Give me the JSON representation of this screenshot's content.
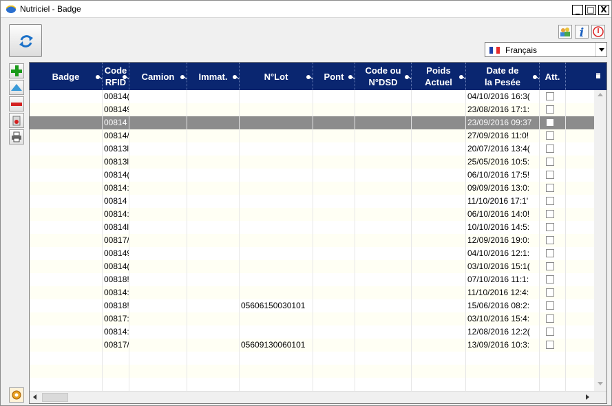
{
  "window": {
    "title": "Nutriciel - Badge",
    "minimize": "_",
    "maximize": "□",
    "close": "X"
  },
  "language": {
    "selected": "Français"
  },
  "colors": {
    "header_bg": "#0a2670",
    "selected_row": "#8c8c8c",
    "odd_row": "#fffff4",
    "add": "#1a9a1a",
    "remove": "#d32020"
  },
  "icons": {
    "refresh": "refresh-icon",
    "users": "users-icon",
    "info": "info-icon",
    "power": "power-icon",
    "add": "add-icon",
    "up": "move-up-icon",
    "remove": "remove-icon",
    "delete": "delete-icon",
    "print": "print-icon",
    "settings": "settings-icon"
  },
  "columns": [
    {
      "key": "badge",
      "label": "Badge"
    },
    {
      "key": "rfid",
      "label": "Code\nRFID"
    },
    {
      "key": "camion",
      "label": "Camion"
    },
    {
      "key": "immat",
      "label": "Immat."
    },
    {
      "key": "lot",
      "label": "N°Lot"
    },
    {
      "key": "pont",
      "label": "Pont"
    },
    {
      "key": "dsd",
      "label": "Code ou\nN°DSD"
    },
    {
      "key": "poids",
      "label": "Poids\nActuel"
    },
    {
      "key": "date",
      "label": "Date de\nla Pesée"
    },
    {
      "key": "att",
      "label": "Att."
    }
  ],
  "rows": [
    {
      "rfid": "00814(",
      "lot": "",
      "date": "04/10/2016 16:3("
    },
    {
      "rfid": "008149",
      "lot": "",
      "date": "23/08/2016 17:1:"
    },
    {
      "rfid": "00814",
      "lot": "",
      "date": "23/09/2016 09:37",
      "selected": true
    },
    {
      "rfid": "00814/",
      "lot": "",
      "date": "27/09/2016 11:0!"
    },
    {
      "rfid": "00813l",
      "lot": "",
      "date": "20/07/2016 13:4("
    },
    {
      "rfid": "00813l",
      "lot": "",
      "date": "25/05/2016 10:5:"
    },
    {
      "rfid": "00814(",
      "lot": "",
      "date": "06/10/2016 17:5!"
    },
    {
      "rfid": "00814:",
      "lot": "",
      "date": "09/09/2016 13:0:"
    },
    {
      "rfid": "00814",
      "lot": "",
      "date": "11/10/2016 17:1'"
    },
    {
      "rfid": "00814:",
      "lot": "",
      "date": "06/10/2016 14:0!"
    },
    {
      "rfid": "00814l",
      "lot": "",
      "date": "10/10/2016 14:5:"
    },
    {
      "rfid": "00817/",
      "lot": "",
      "date": "12/09/2016 19:0:"
    },
    {
      "rfid": "008149",
      "lot": "",
      "date": "04/10/2016 12:1:"
    },
    {
      "rfid": "00814(",
      "lot": "",
      "date": "03/10/2016 15:1("
    },
    {
      "rfid": "00818!",
      "lot": "",
      "date": "07/10/2016 11:1:"
    },
    {
      "rfid": "00814:",
      "lot": "",
      "date": "11/10/2016 12:4:"
    },
    {
      "rfid": "00818!",
      "lot": "05606150030101",
      "date": "15/06/2016 08:2:"
    },
    {
      "rfid": "00817:",
      "lot": "",
      "date": "03/10/2016 15:4:"
    },
    {
      "rfid": "00814:",
      "lot": "",
      "date": "12/08/2016 12:2("
    },
    {
      "rfid": "00817/",
      "lot": "05609130060101",
      "date": "13/09/2016 10:3:"
    },
    {
      "rfid": "",
      "lot": "",
      "date": "",
      "empty": true
    },
    {
      "rfid": "",
      "lot": "",
      "date": "",
      "empty": true
    },
    {
      "rfid": "",
      "lot": "",
      "date": "",
      "empty": true
    }
  ]
}
